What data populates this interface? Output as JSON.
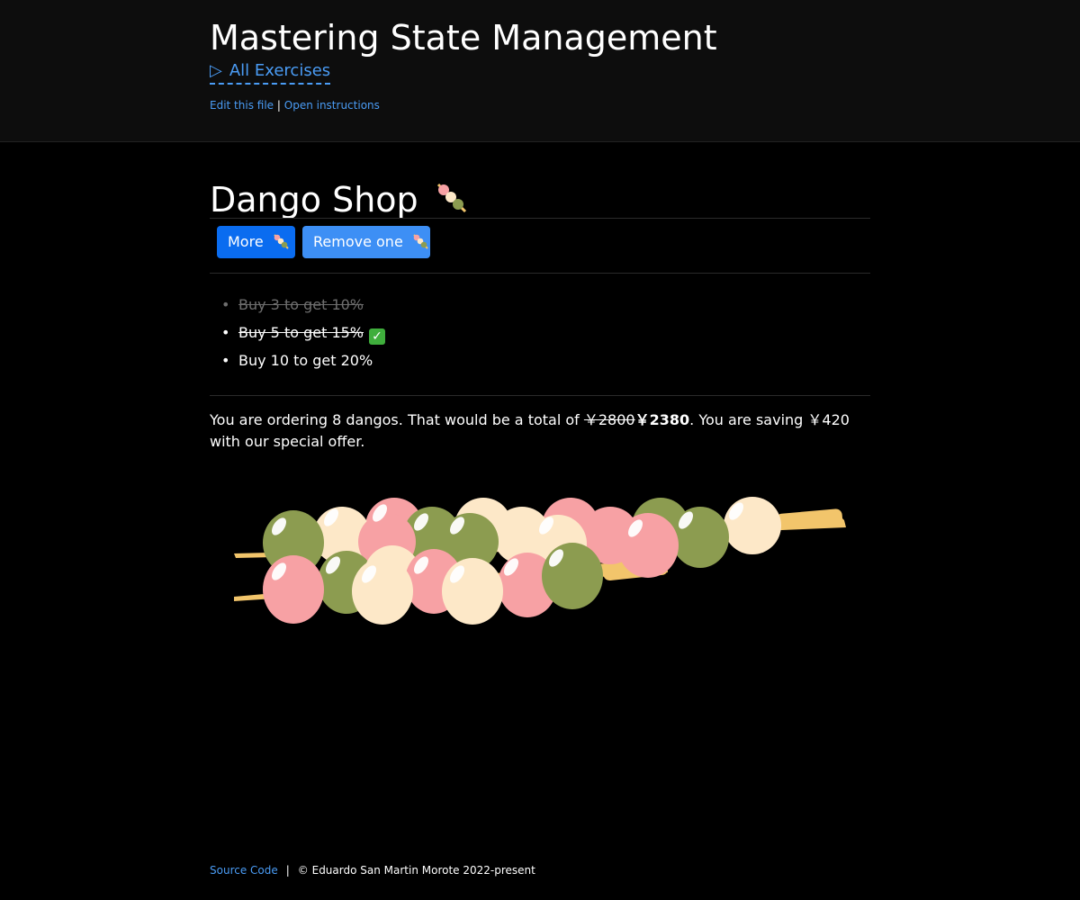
{
  "header": {
    "title": "Mastering State Management",
    "all_exercises": "All Exercises",
    "edit_link": "Edit this file",
    "separator": "|",
    "instructions_link": "Open instructions"
  },
  "shop": {
    "heading": "Dango Shop",
    "more_label": "More",
    "remove_label": "Remove one",
    "offers": [
      {
        "text": "Buy 3 to get 10%",
        "status": "expired"
      },
      {
        "text": "Buy 5 to get 15%",
        "status": "applied"
      },
      {
        "text": "Buy 10 to get 20%",
        "status": "available"
      }
    ],
    "summary": {
      "prefix": "You are ordering 8 dangos. That would be a total of ",
      "old_price": "￥2800",
      "new_price": "￥2380",
      "suffix": ". You are saving ￥420 with our special offer."
    },
    "dango_count": 8
  },
  "footer": {
    "source_link": "Source Code",
    "separator": "|",
    "copyright": "© Eduardo San Martin Morote 2022-present"
  },
  "colors": {
    "pink": "#f7a1a4",
    "white": "#fde8c8",
    "green": "#8c9c50",
    "stick": "#f2c56b",
    "link": "#4a9cf5",
    "button_primary": "#0a6cf0"
  }
}
